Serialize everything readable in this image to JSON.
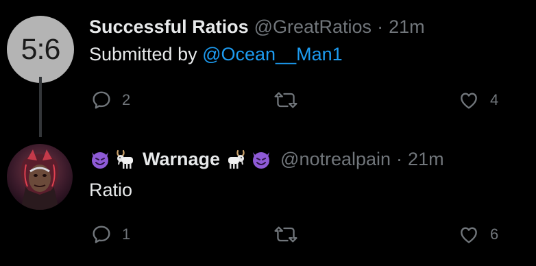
{
  "tweets": [
    {
      "avatar_text": "5:6",
      "display_name": "Successful Ratios",
      "handle": "@GreatRatios",
      "separator": "·",
      "time": "21m",
      "body_prefix": "Submitted by ",
      "mention": "@Ocean__Man1",
      "reply_count": "2",
      "like_count": "4"
    },
    {
      "display_name": "Warnage",
      "handle": "@notrealpain",
      "separator": "·",
      "time": "21m",
      "body": "Ratio",
      "reply_count": "1",
      "like_count": "6",
      "name_emoji_before": [
        "smiling-devil-emoji",
        "goat-emoji"
      ],
      "name_emoji_after": [
        "goat-emoji",
        "smiling-devil-emoji"
      ]
    }
  ],
  "colors": {
    "background": "#000000",
    "text": "#e7e9ea",
    "muted": "#71767b",
    "mention": "#1d9bf0",
    "thread_line": "#333639"
  }
}
